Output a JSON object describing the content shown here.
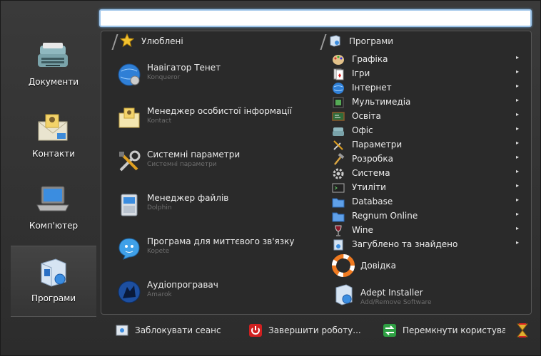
{
  "search": {
    "value": "",
    "placeholder": ""
  },
  "sidebar": {
    "items": [
      {
        "label": "Документи",
        "icon": "typewriter-icon"
      },
      {
        "label": "Контакти",
        "icon": "contacts-envelope-icon"
      },
      {
        "label": "Комп'ютер",
        "icon": "laptop-icon"
      },
      {
        "label": "Програми",
        "icon": "applications-box-icon",
        "active": true
      }
    ]
  },
  "favorites": {
    "header": "Улюблені",
    "items": [
      {
        "name": "Навігатор Тенет",
        "sub": "Konqueror",
        "icon": "globe-gear-icon"
      },
      {
        "name": "Менеджер особистої інформації",
        "sub": "Kontact",
        "icon": "kontact-icon"
      },
      {
        "name": "Системні параметри",
        "sub": "Системні параметри",
        "icon": "tools-icon"
      },
      {
        "name": "Менеджер файлів",
        "sub": "Dolphin",
        "icon": "file-cabinet-icon"
      },
      {
        "name": "Програма для миттєвого зв'язку",
        "sub": "Kopete",
        "icon": "chat-face-icon"
      },
      {
        "name": "Аудіопрогравач",
        "sub": "Amarok",
        "icon": "wolf-icon"
      }
    ]
  },
  "programs": {
    "header": "Програми",
    "items": [
      {
        "label": "Графіка",
        "icon": "palette-icon"
      },
      {
        "label": "Ігри",
        "icon": "cards-icon"
      },
      {
        "label": "Інтернет",
        "icon": "globe-icon"
      },
      {
        "label": "Мультимедіа",
        "icon": "film-icon"
      },
      {
        "label": "Освіта",
        "icon": "blackboard-icon"
      },
      {
        "label": "Офіс",
        "icon": "typewriter-icon"
      },
      {
        "label": "Параметри",
        "icon": "tools-icon"
      },
      {
        "label": "Розробка",
        "icon": "hammer-icon"
      },
      {
        "label": "Система",
        "icon": "gear-icon"
      },
      {
        "label": "Утиліти",
        "icon": "terminal-icon"
      },
      {
        "label": "Database",
        "icon": "folder-icon"
      },
      {
        "label": "Regnum Online",
        "icon": "folder-icon"
      },
      {
        "label": "Wine",
        "icon": "wine-glass-icon"
      },
      {
        "label": "Загублено та знайдено",
        "icon": "package-icon"
      }
    ],
    "help": {
      "label": "Довідка",
      "icon": "lifebuoy-icon"
    },
    "adept": {
      "name": "Adept Installer",
      "sub": "Add/Remove Software",
      "icon": "package-install-icon"
    }
  },
  "bottom": {
    "lock": "Заблокувати сеанс",
    "shutdown": "Завершити роботу...",
    "switch": "Перемкнути користувача"
  },
  "colors": {
    "accent": "#6aa8e0",
    "panel": "#2a2a2a",
    "text": "#ececec",
    "subtext": "#6e6e6e"
  }
}
